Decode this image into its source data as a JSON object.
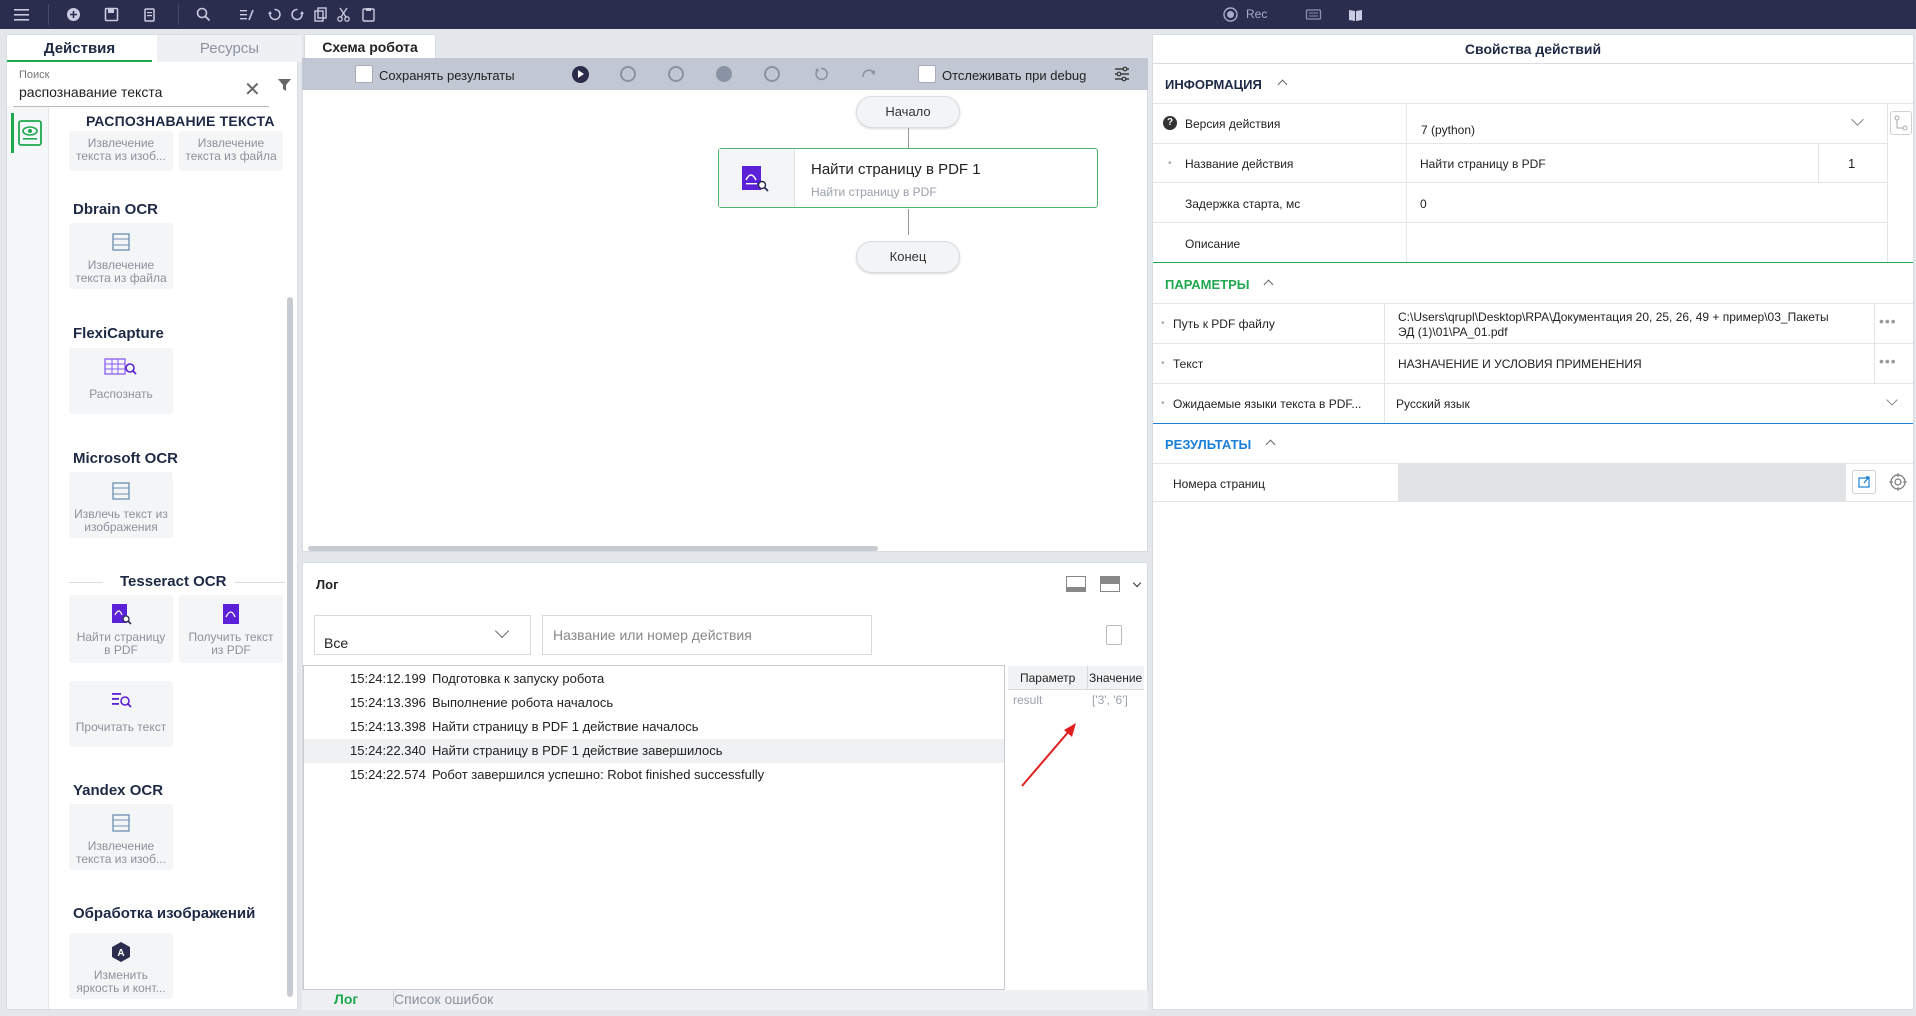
{
  "toolbar": {
    "icons": [
      "menu-icon",
      "add-icon",
      "save-icon",
      "clipboard-icon",
      "search-icon",
      "edit-list-icon",
      "undo-icon",
      "redo-icon",
      "copy-icon",
      "cut-icon",
      "paste-icon"
    ],
    "rec_label": "Rec"
  },
  "left_panel": {
    "tabs": [
      "Действия",
      "Ресурсы"
    ],
    "search_label": "Поиск",
    "search_value": "распознавание текста",
    "groups": [
      {
        "title": "РАСПОЗНАВАНИЕ ТЕКСТА",
        "cards": [
          "Извлечение текста из изоб...",
          "Извлечение текста из файла"
        ]
      },
      {
        "title": "Dbrain OCR",
        "cards": [
          "Извлечение текста из файла"
        ]
      },
      {
        "title": "FlexiCapture",
        "cards": [
          "Распознать"
        ]
      },
      {
        "title": "Microsoft OCR",
        "cards": [
          "Извлечь текст из изображения"
        ]
      },
      {
        "title": "Tesseract OCR",
        "cards": [
          "Найти страницу в PDF",
          "Получить текст из PDF",
          "Прочитать текст"
        ]
      },
      {
        "title": "Yandex OCR",
        "cards": [
          "Извлечение текста из изоб..."
        ]
      },
      {
        "title": "Обработка изображений",
        "cards": [
          "Изменить яркость и конт..."
        ]
      }
    ]
  },
  "schema": {
    "tab": "Схема робота",
    "save_results": "Сохранять результаты",
    "track_debug": "Отслеживать при debug",
    "start_node": "Начало",
    "end_node": "Конец",
    "action_node": {
      "title": "Найти страницу в PDF  1",
      "subtitle": "Найти страницу в PDF"
    }
  },
  "log": {
    "title": "Лог",
    "filter_value": "Все",
    "search_placeholder": "Название или номер действия",
    "rows": [
      {
        "ts": "15:24:12.199",
        "msg": "Подготовка к запуску робота"
      },
      {
        "ts": "15:24:13.396",
        "msg": "Выполнение робота началось"
      },
      {
        "ts": "15:24:13.398",
        "msg": "Найти страницу в PDF 1 действие началось"
      },
      {
        "ts": "15:24:22.340",
        "msg": "Найти страницу в PDF 1 действие завершилось"
      },
      {
        "ts": "15:24:22.574",
        "msg": "Робот завершился успешно: Robot finished successfully"
      }
    ],
    "param_header": "Параметр",
    "value_header": "Значение",
    "param_name": "result",
    "param_value": "['3', '6']",
    "tabs": [
      "Лог",
      "Список ошибок"
    ]
  },
  "props": {
    "title": "Свойства действий",
    "info_section": "ИНФОРМАЦИЯ",
    "version_label": "Версия действия",
    "version_value": "7 (python)",
    "name_label": "Название действия",
    "name_value": "Найти страницу в PDF",
    "name_number": "1",
    "delay_label": "Задержка старта, мс",
    "delay_value": "0",
    "desc_label": "Описание",
    "params_section": "ПАРАМЕТРЫ",
    "path_label": "Путь к PDF файлу",
    "path_value_line1": "C:\\Users\\qrupl\\Desktop\\RPA\\Документация 20, 25, 26, 49 + пример\\03_Пакеты",
    "path_value_line2": "ЭД (1)\\01\\PA_01.pdf",
    "text_label": "Текст",
    "text_value": "НАЗНАЧЕНИЕ И УСЛОВИЯ ПРИМЕНЕНИЯ",
    "lang_label": "Ожидаемые языки текста в PDF...",
    "lang_value": "Русский язык",
    "results_section": "РЕЗУЛЬТАТЫ",
    "pages_label": "Номера страниц"
  },
  "colors": {
    "toolbar_bg": "#2b2d4f",
    "accent_green": "#1fa84f",
    "accent_blue": "#1a7fd6",
    "icon_purple": "#5b21d8"
  }
}
